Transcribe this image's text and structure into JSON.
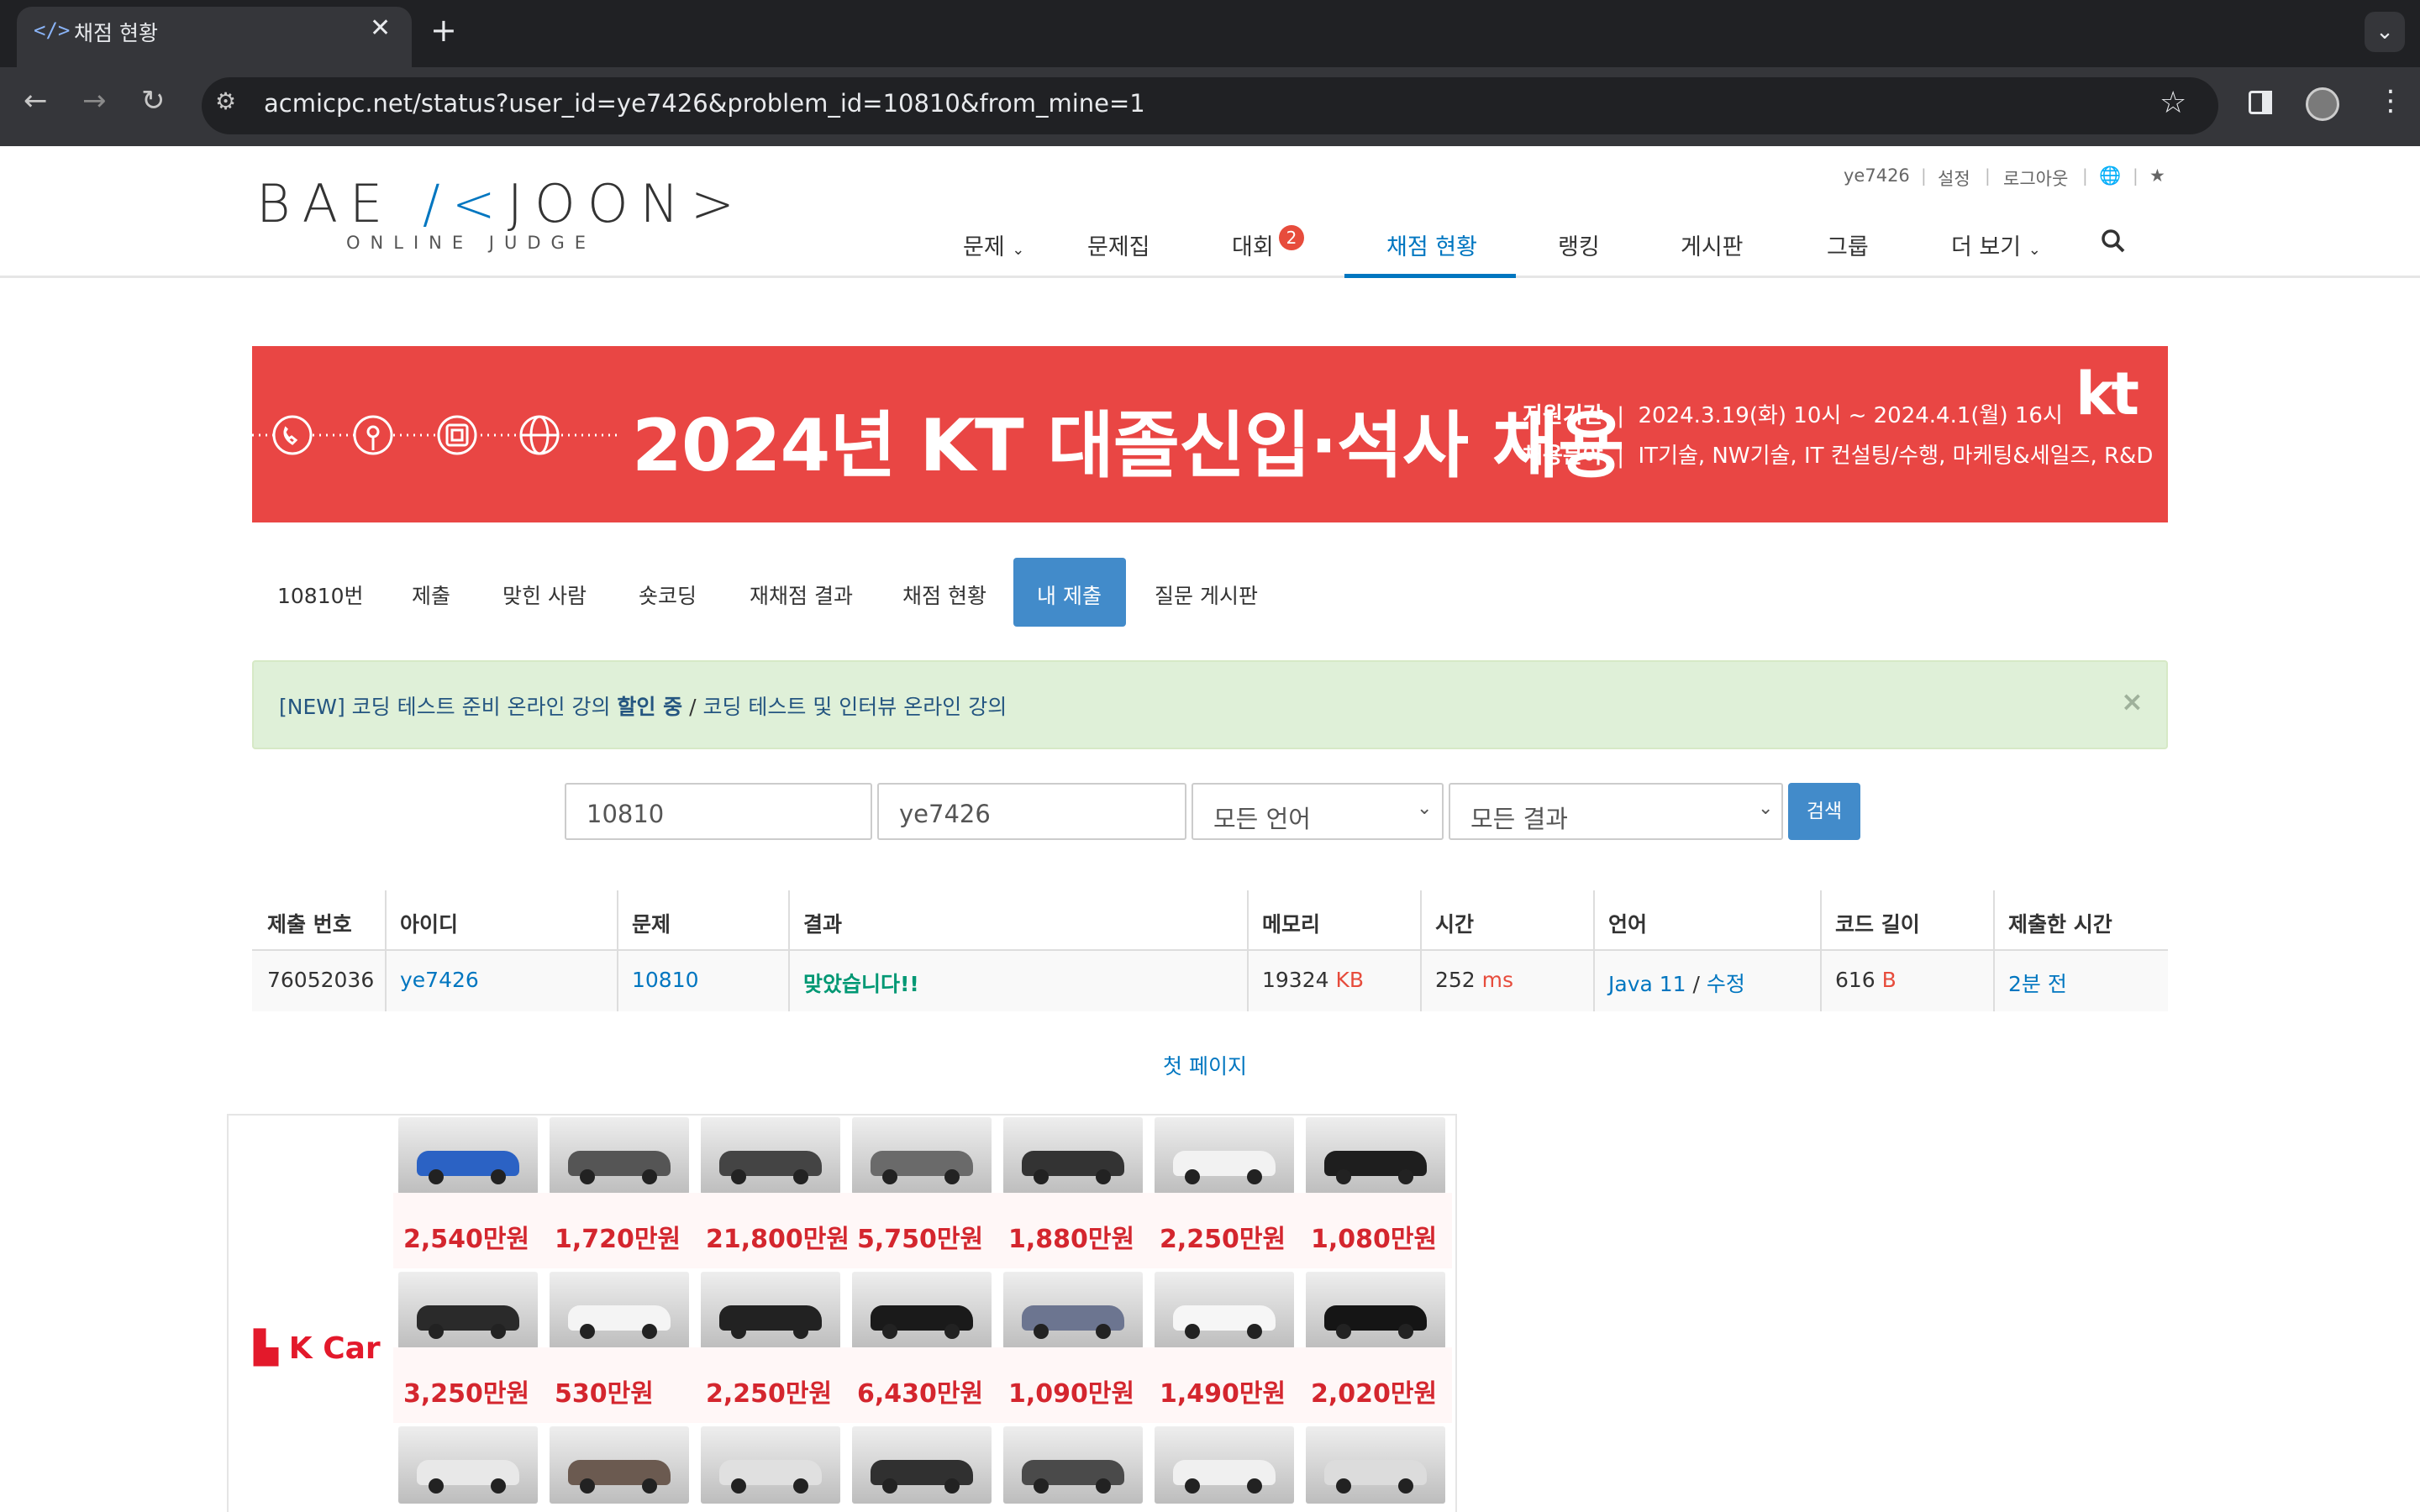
{
  "browser": {
    "tab_title": "채점 현황",
    "tab_icon": "</>",
    "url": "acmicpc.net/status?user_id=ye7426&problem_id=10810&from_mine=1"
  },
  "header": {
    "logo_main_a": "BAE",
    "logo_main_k": "/<",
    "logo_main_b": "JOON>",
    "logo_sub": "ONLINE JUDGE",
    "top_links": [
      "ye7426",
      "설정",
      "로그아웃"
    ],
    "nav": [
      "문제",
      "문제집",
      "대회",
      "채점 현황",
      "랭킹",
      "게시판",
      "그룹",
      "더 보기"
    ],
    "contest_badge": "2",
    "active_nav": "채점 현황"
  },
  "banner": {
    "title": "2024년 KT 대졸신입·석사 채용",
    "line1_label": "지원기간",
    "line1_value": "2024.3.19(화) 10시 ~ 2024.4.1(월) 16시",
    "line2_label": "채용분야",
    "line2_value": "IT기술, NW기술, IT 컨설팅/수행, 마케팅&세일즈, R&D",
    "logo": "kt",
    "bg_color": "#e94644"
  },
  "submenu": {
    "items": [
      "10810번",
      "제출",
      "맞힌 사람",
      "숏코딩",
      "재채점 결과",
      "채점 현황",
      "내 제출",
      "질문 게시판"
    ],
    "active": "내 제출"
  },
  "alert": {
    "prefix": "[NEW] 코딩 테스트 준비 온라인 강의",
    "bold": "할인 중",
    "sep": " / ",
    "suffix": "코딩 테스트 및 인터뷰 온라인 강의",
    "close": "×"
  },
  "search": {
    "problem_id": "10810",
    "user_id": "ye7426",
    "language": "모든 언어",
    "result": "모든 결과",
    "button": "검색"
  },
  "table": {
    "headers": [
      "제출 번호",
      "아이디",
      "문제",
      "결과",
      "메모리",
      "시간",
      "언어",
      "코드 길이",
      "제출한 시간"
    ],
    "row": {
      "submission_id": "76052036",
      "user": "ye7426",
      "problem": "10810",
      "result": "맞았습니다!!",
      "memory": "19324",
      "memory_unit": "KB",
      "time": "252",
      "time_unit": "ms",
      "language": "Java 11",
      "lang_sep": " / ",
      "edit": "수정",
      "code_length": "616",
      "code_unit": "B",
      "submitted": "2분 전"
    }
  },
  "pagination": {
    "first_page": "첫 페이지"
  },
  "ad": {
    "logo": "K Car",
    "prices_row1": [
      "2,540만원",
      "1,720만원",
      "21,800만원",
      "5,750만원",
      "1,880만원",
      "2,250만원",
      "1,080만원"
    ],
    "prices_row2": [
      "3,250만원",
      "530만원",
      "2,250만원",
      "6,430만원",
      "1,090만원",
      "1,490만원",
      "2,020만원"
    ],
    "car_colors_row1": [
      "#2b62c4",
      "#555555",
      "#444444",
      "#6a6a6a",
      "#333333",
      "#f2f2f2",
      "#1e1e1e"
    ],
    "car_colors_row2": [
      "#2a2a2a",
      "#f4f4f4",
      "#222222",
      "#1a1a1a",
      "#6c7590",
      "#f6f6f6",
      "#151515"
    ],
    "car_colors_row3": [
      "#e8e8e8",
      "#6b5a50",
      "#e0e0e0",
      "#303030",
      "#4a4a4a",
      "#f0f0f0",
      "#dcdcdc"
    ]
  }
}
